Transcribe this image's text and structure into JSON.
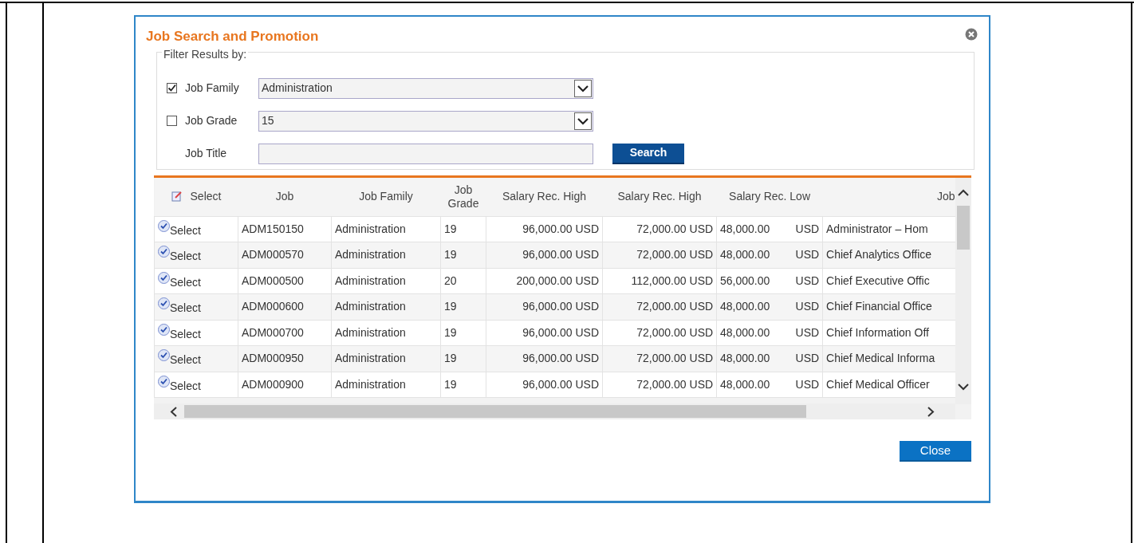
{
  "dialog": {
    "title": "Job Search and Promotion",
    "filter": {
      "legend": "Filter Results by:",
      "job_family": {
        "label": "Job Family",
        "checked": true,
        "value": "Administration"
      },
      "job_grade": {
        "label": "Job Grade",
        "checked": false,
        "value": "15"
      },
      "job_title": {
        "label": "Job Title"
      },
      "search_button": "Search"
    },
    "table": {
      "columns": [
        "Select",
        "Job",
        "Job Family",
        "Job Grade",
        "Salary Rec. High",
        "Salary Rec. High",
        "Salary Rec. Low",
        "Job"
      ],
      "rows": [
        {
          "select": "Select",
          "job": "ADM150150",
          "family": "Administration",
          "grade": "19",
          "high_1": "96,000.00",
          "currency_1": "USD",
          "high_2": "72,000.00",
          "currency_2": "USD",
          "low": "48,000.00",
          "currency_3": "USD",
          "title": "Administrator – Hom"
        },
        {
          "select": "Select",
          "job": "ADM000570",
          "family": "Administration",
          "grade": "19",
          "high_1": "96,000.00",
          "currency_1": "USD",
          "high_2": "72,000.00",
          "currency_2": "USD",
          "low": "48,000.00",
          "currency_3": "USD",
          "title": "Chief Analytics Office"
        },
        {
          "select": "Select",
          "job": "ADM000500",
          "family": "Administration",
          "grade": "20",
          "high_1": "200,000.00",
          "currency_1": "USD",
          "high_2": "112,000.00",
          "currency_2": "USD",
          "low": "56,000.00",
          "currency_3": "USD",
          "title": "Chief Executive Offic"
        },
        {
          "select": "Select",
          "job": "ADM000600",
          "family": "Administration",
          "grade": "19",
          "high_1": "96,000.00",
          "currency_1": "USD",
          "high_2": "72,000.00",
          "currency_2": "USD",
          "low": "48,000.00",
          "currency_3": "USD",
          "title": "Chief Financial Office"
        },
        {
          "select": "Select",
          "job": "ADM000700",
          "family": "Administration",
          "grade": "19",
          "high_1": "96,000.00",
          "currency_1": "USD",
          "high_2": "72,000.00",
          "currency_2": "USD",
          "low": "48,000.00",
          "currency_3": "USD",
          "title": "Chief Information Off"
        },
        {
          "select": "Select",
          "job": "ADM000950",
          "family": "Administration",
          "grade": "19",
          "high_1": "96,000.00",
          "currency_1": "USD",
          "high_2": "72,000.00",
          "currency_2": "USD",
          "low": "48,000.00",
          "currency_3": "USD",
          "title": "Chief Medical Informa"
        },
        {
          "select": "Select",
          "job": "ADM000900",
          "family": "Administration",
          "grade": "19",
          "high_1": "96,000.00",
          "currency_1": "USD",
          "high_2": "72,000.00",
          "currency_2": "USD",
          "low": "48,000.00",
          "currency_3": "USD",
          "title": "Chief Medical Officer"
        }
      ]
    },
    "close_button": "Close"
  }
}
